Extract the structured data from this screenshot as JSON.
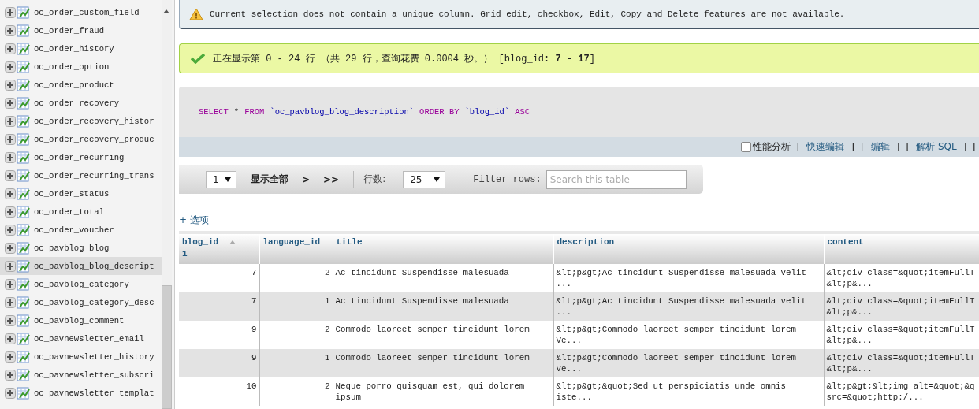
{
  "sidebar": {
    "items": [
      {
        "name": "oc_order_custom_field",
        "selected": false
      },
      {
        "name": "oc_order_fraud",
        "selected": false
      },
      {
        "name": "oc_order_history",
        "selected": false
      },
      {
        "name": "oc_order_option",
        "selected": false
      },
      {
        "name": "oc_order_product",
        "selected": false
      },
      {
        "name": "oc_order_recovery",
        "selected": false
      },
      {
        "name": "oc_order_recovery_histor",
        "selected": false
      },
      {
        "name": "oc_order_recovery_produc",
        "selected": false
      },
      {
        "name": "oc_order_recurring",
        "selected": false
      },
      {
        "name": "oc_order_recurring_trans",
        "selected": false
      },
      {
        "name": "oc_order_status",
        "selected": false
      },
      {
        "name": "oc_order_total",
        "selected": false
      },
      {
        "name": "oc_order_voucher",
        "selected": false
      },
      {
        "name": "oc_pavblog_blog",
        "selected": false
      },
      {
        "name": "oc_pavblog_blog_descript",
        "selected": true
      },
      {
        "name": "oc_pavblog_category",
        "selected": false
      },
      {
        "name": "oc_pavblog_category_desc",
        "selected": false
      },
      {
        "name": "oc_pavblog_comment",
        "selected": false
      },
      {
        "name": "oc_pavnewsletter_email",
        "selected": false
      },
      {
        "name": "oc_pavnewsletter_history",
        "selected": false
      },
      {
        "name": "oc_pavnewsletter_subscri",
        "selected": false
      },
      {
        "name": "oc_pavnewsletter_templat",
        "selected": false
      }
    ]
  },
  "notice": {
    "text": "Current selection does not contain a unique column. Grid edit, checkbox, Edit, Copy and Delete features are not available."
  },
  "success": {
    "text": "正在显示第 0 - 24 行 （共 29 行，查询花费 0.0004 秒。） [blog_id: **7 - 17**]"
  },
  "sql": {
    "tokens": [
      {
        "kind": "keyword",
        "text": "SELECT",
        "link": true
      },
      {
        "kind": "operator",
        "text": "*"
      },
      {
        "kind": "keyword",
        "text": "FROM"
      },
      {
        "kind": "identifier",
        "text": "`oc_pavblog_blog_description`"
      },
      {
        "kind": "keyword",
        "text": "ORDER BY"
      },
      {
        "kind": "identifier",
        "text": "`blog_id`"
      },
      {
        "kind": "keyword",
        "text": "ASC"
      }
    ],
    "profiling": {
      "label": "性能分析",
      "checked": false
    },
    "actions": [
      {
        "kind": "bracket",
        "text": "["
      },
      {
        "kind": "link",
        "text": "快速编辑"
      },
      {
        "kind": "bracket",
        "text": "]"
      },
      {
        "kind": "bracket",
        "text": "["
      },
      {
        "kind": "link",
        "text": "编辑"
      },
      {
        "kind": "bracket",
        "text": "]"
      },
      {
        "kind": "bracket",
        "text": "["
      },
      {
        "kind": "link",
        "text": "解析 SQL"
      },
      {
        "kind": "bracket",
        "text": "]"
      },
      {
        "kind": "bracket",
        "text": "["
      }
    ]
  },
  "navigation": {
    "page": "1",
    "show_all": "显示全部",
    "next": ">",
    "last": ">>",
    "rows_label": "行数:",
    "rows_value": "25",
    "filter_label": "Filter rows:",
    "filter_placeholder": "Search this table"
  },
  "options_link": "+ 选项",
  "table": {
    "columns": [
      {
        "label": "blog_id",
        "sort_index": "1"
      },
      {
        "label": "language_id"
      },
      {
        "label": "title"
      },
      {
        "label": "description"
      },
      {
        "label": "content"
      }
    ],
    "rows": [
      [
        "7",
        "2",
        "Ac tincidunt Suspendisse malesuada",
        "&lt;p&gt;Ac tincidunt Suspendisse malesuada velit\n...",
        "&lt;div class=&quot;itemFullT\n&lt;p&..."
      ],
      [
        "7",
        "1",
        "Ac tincidunt Suspendisse malesuada",
        "&lt;p&gt;Ac tincidunt Suspendisse malesuada velit\n...",
        "&lt;div class=&quot;itemFullT\n&lt;p&..."
      ],
      [
        "9",
        "2",
        "Commodo laoreet semper tincidunt lorem",
        "&lt;p&gt;Commodo laoreet semper tincidunt lorem\nVe...",
        "&lt;div class=&quot;itemFullT\n&lt;p&..."
      ],
      [
        "9",
        "1",
        "Commodo laoreet semper tincidunt lorem",
        "&lt;p&gt;Commodo laoreet semper tincidunt lorem\nVe...",
        "&lt;div class=&quot;itemFullT\n&lt;p&..."
      ],
      [
        "10",
        "2",
        "Neque porro quisquam est, qui dolorem\nipsum",
        "&lt;p&gt;&quot;Sed ut perspiciatis unde omnis\niste...",
        "&lt;p&gt;&lt;img alt=&quot;&q\nsrc=&quot;http:/..."
      ]
    ]
  }
}
